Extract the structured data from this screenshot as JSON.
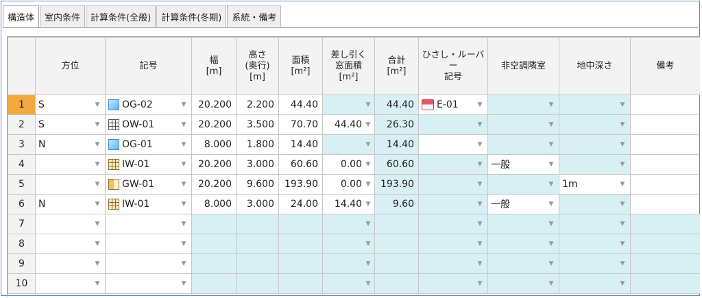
{
  "tabs": [
    "構造体",
    "室内条件",
    "計算条件(全般)",
    "計算条件(冬期)",
    "系統・備考"
  ],
  "headers": {
    "direction": "方位",
    "code": "記号",
    "width": "幅\n[m]",
    "height": "高さ\n(奥行)\n[m]",
    "area": "面積\n[m²]",
    "deduct": "差し引く\n窓面積\n[m²]",
    "total": "合計\n[m²]",
    "eave": "ひさし・ルーバー\n記号",
    "nonac": "非空調隣室",
    "depth": "地中深さ",
    "remarks": "備考"
  },
  "rows": [
    {
      "no": "1",
      "dir": "S",
      "icon": "glass-window-icon",
      "code": "OG-02",
      "width": "20.200",
      "height": "2.200",
      "area": "44.40",
      "deduct": "",
      "total": "44.40",
      "eave": "E-01",
      "nonac": "",
      "depth": ""
    },
    {
      "no": "2",
      "dir": "S",
      "icon": "grid-wall-icon",
      "code": "OW-01",
      "width": "20.200",
      "height": "3.500",
      "area": "70.70",
      "deduct": "44.40",
      "total": "26.30",
      "eave": "",
      "nonac": "",
      "depth": ""
    },
    {
      "no": "3",
      "dir": "N",
      "icon": "glass-window-icon",
      "code": "OG-01",
      "width": "8.000",
      "height": "1.800",
      "area": "14.40",
      "deduct": "",
      "total": "14.40",
      "eave": "",
      "nonac": "",
      "depth": ""
    },
    {
      "no": "4",
      "dir": "",
      "icon": "inner-wall-icon",
      "code": "IW-01",
      "width": "20.200",
      "height": "3.000",
      "area": "60.60",
      "deduct": "0.00",
      "total": "60.60",
      "eave": "",
      "nonac": "一般",
      "depth": ""
    },
    {
      "no": "5",
      "dir": "",
      "icon": "ground-wall-icon",
      "code": "GW-01",
      "width": "20.200",
      "height": "9.600",
      "area": "193.90",
      "deduct": "0.00",
      "total": "193.90",
      "eave": "",
      "nonac": "",
      "depth": "1m"
    },
    {
      "no": "6",
      "dir": "N",
      "icon": "inner-wall-icon",
      "code": "IW-01",
      "width": "8.000",
      "height": "3.000",
      "area": "24.00",
      "deduct": "14.40",
      "total": "9.60",
      "eave": "",
      "nonac": "一般",
      "depth": ""
    },
    {
      "no": "7",
      "dir": "",
      "icon": "",
      "code": "",
      "width": "",
      "height": "",
      "area": "",
      "deduct": "",
      "total": "",
      "eave": "",
      "nonac": "",
      "depth": ""
    },
    {
      "no": "8",
      "dir": "",
      "icon": "",
      "code": "",
      "width": "",
      "height": "",
      "area": "",
      "deduct": "",
      "total": "",
      "eave": "",
      "nonac": "",
      "depth": ""
    },
    {
      "no": "9",
      "dir": "",
      "icon": "",
      "code": "",
      "width": "",
      "height": "",
      "area": "",
      "deduct": "",
      "total": "",
      "eave": "",
      "nonac": "",
      "depth": ""
    },
    {
      "no": "10",
      "dir": "",
      "icon": "",
      "code": "",
      "width": "",
      "height": "",
      "area": "",
      "deduct": "",
      "total": "",
      "eave": "",
      "nonac": "",
      "depth": ""
    }
  ],
  "colors": {
    "accent": "#5b86c5",
    "selected_row": "#f2aa3e",
    "computed_cell": "#d8f0f3",
    "header": "#f3f3f3"
  }
}
